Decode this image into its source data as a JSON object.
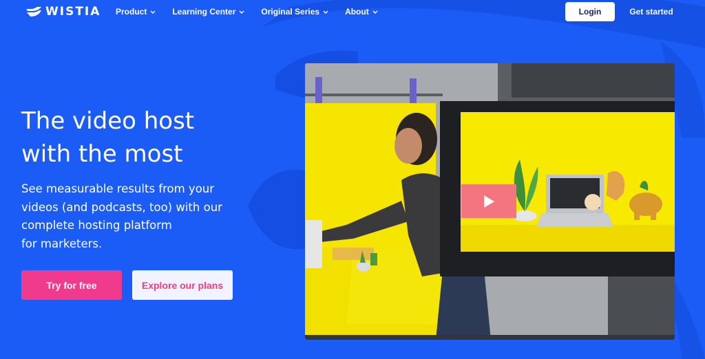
{
  "brand": {
    "name": "WISTIA"
  },
  "nav": {
    "items": [
      {
        "label": "Product",
        "icon": "chevron-down-icon"
      },
      {
        "label": "Learning Center",
        "icon": "chevron-down-icon"
      },
      {
        "label": "Original Series",
        "icon": "chevron-down-icon"
      },
      {
        "label": "About",
        "icon": "chevron-down-icon"
      }
    ],
    "login_label": "Login",
    "get_started_label": "Get started"
  },
  "hero": {
    "title_line1": "The video host",
    "title_line2": "with the most",
    "subtitle_lines": [
      "See measurable results from your",
      "videos (and podcasts, too) with our",
      "complete hosting platform",
      "for marketers."
    ],
    "primary_cta": "Try for free",
    "secondary_cta": "Explore our plans"
  },
  "video": {
    "play_icon": "play-icon"
  },
  "colors": {
    "background": "#1a5cf5",
    "accent_pink": "#ef3a8e",
    "play_button": "#f2757f",
    "video_yellow": "#f5e500"
  }
}
